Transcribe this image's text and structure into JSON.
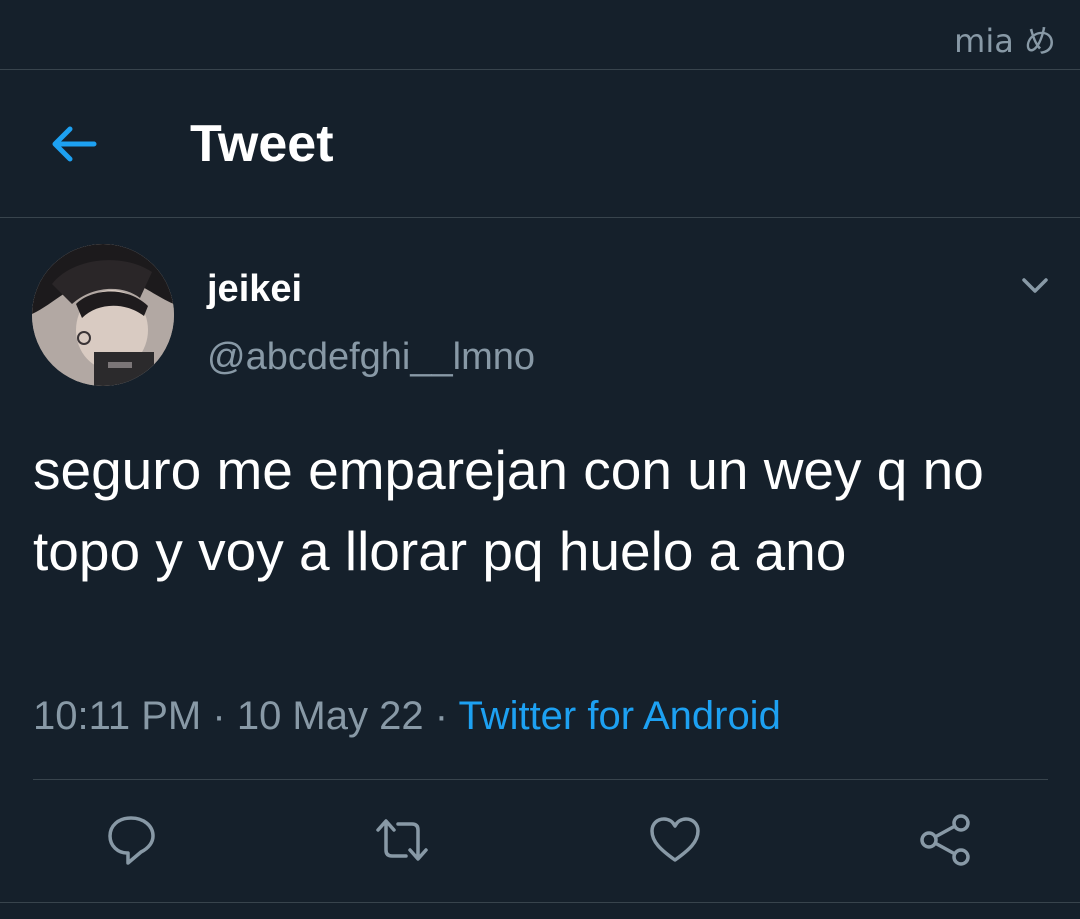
{
  "watermark": "mia め",
  "header": {
    "back_icon": "arrow-left-icon",
    "title": "Tweet"
  },
  "tweet": {
    "author": {
      "display_name": "jeikei",
      "handle": "@abcdefghi__lmno",
      "avatar": "avatar-photo"
    },
    "text": "seguro me emparejan con un wey q no topo y voy a llorar pq huelo a ano",
    "time": "10:11 PM",
    "separator": "·",
    "date": "10 May 22",
    "source": "Twitter for Android",
    "menu_icon": "chevron-down-icon"
  },
  "actions": [
    {
      "name": "reply",
      "icon": "reply-icon"
    },
    {
      "name": "retweet",
      "icon": "retweet-icon"
    },
    {
      "name": "like",
      "icon": "heart-icon"
    },
    {
      "name": "share",
      "icon": "share-icon"
    }
  ],
  "colors": {
    "background": "#15202b",
    "divider": "#38444d",
    "accent": "#1da1f2",
    "secondary_text": "#8899a6",
    "primary_text": "#ffffff"
  }
}
